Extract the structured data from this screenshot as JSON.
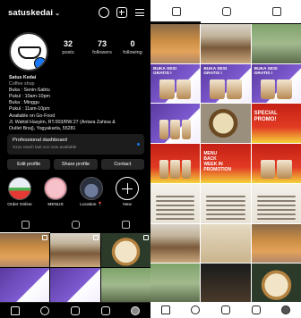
{
  "profile": {
    "username": "satuskedai",
    "chevron": "⌄",
    "topbar_icons": [
      "threads-icon",
      "add-post-icon",
      "menu-icon"
    ],
    "stats": [
      {
        "value": "32",
        "label": "posts"
      },
      {
        "value": "73",
        "label": "followers"
      },
      {
        "value": "0",
        "label": "following"
      }
    ],
    "bio": {
      "name": "Satus Kedai",
      "category": "Coffee shop",
      "lines": [
        "Buka : Senin-Sabtu",
        "Pukul : 10am-10pm",
        "Buka : Minggu",
        "Pukul : 11am-10pm",
        "Available on Go-Food",
        "Jl. Wahid Hasyim, RT.003/RW.27 (Antara Zahisa &",
        "Outlet Bnsj), Yogyakarta, 55281"
      ]
    },
    "dashboard": {
      "title": "Professional dashboard",
      "subtitle": "Xxxx reach last xxx now available"
    },
    "buttons": {
      "edit": "Edit profile",
      "share": "Share profile",
      "contact": "Contact"
    },
    "highlights": [
      {
        "label": "Order Online"
      },
      {
        "label": "MENUS"
      },
      {
        "label": "Location 📍"
      },
      {
        "label": "New"
      }
    ]
  },
  "nav": [
    "home-icon",
    "search-icon",
    "add-icon",
    "reels-icon",
    "profile-avatar"
  ],
  "posts": {
    "promo_label_1": "BUKA SESI\nGRATIS !",
    "promo_label_2": "SPECIAL\nPROMO!",
    "menu_label": "MENU\nBACK\nWEEK IN\nPROMOTION"
  }
}
